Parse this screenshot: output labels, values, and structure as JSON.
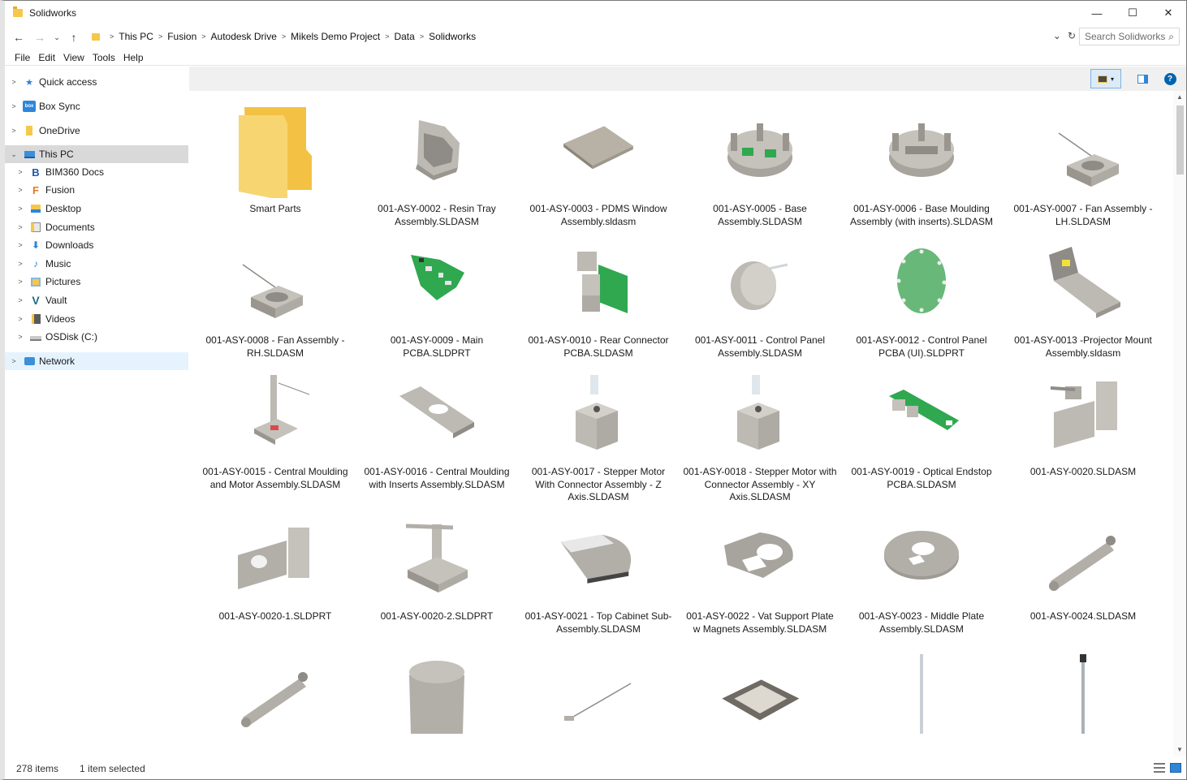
{
  "window": {
    "title": "Solidworks",
    "minimize": "—",
    "maximize": "☐",
    "close": "✕"
  },
  "address": {
    "crumbs": [
      "This PC",
      "Fusion",
      "Autodesk Drive",
      "Mikels Demo Project",
      "Data",
      "Solidworks"
    ],
    "search_placeholder": "Search Solidworks"
  },
  "menu": [
    "File",
    "Edit",
    "View",
    "Tools",
    "Help"
  ],
  "nav": {
    "quick_access": "Quick access",
    "box_sync": "Box Sync",
    "onedrive": "OneDrive",
    "this_pc": "This PC",
    "bim360": "BIM360 Docs",
    "fusion": "Fusion",
    "desktop": "Desktop",
    "documents": "Documents",
    "downloads": "Downloads",
    "music": "Music",
    "pictures": "Pictures",
    "vault": "Vault",
    "videos": "Videos",
    "osdisk": "OSDisk (C:)",
    "network": "Network",
    "icon_box": "box",
    "icon_bim": "B",
    "icon_fusion": "F",
    "icon_vault": "V"
  },
  "files": [
    "Smart Parts",
    "001-ASY-0002 - Resin Tray Assembly.SLDASM",
    "001-ASY-0003 - PDMS Window Assembly.sldasm",
    "001-ASY-0005 - Base Assembly.SLDASM",
    "001-ASY-0006 - Base Moulding Assembly (with inserts).SLDASM",
    "001-ASY-0007 - Fan Assembly - LH.SLDASM",
    "001-ASY-0008 - Fan Assembly - RH.SLDASM",
    "001-ASY-0009 - Main PCBA.SLDPRT",
    "001-ASY-0010 - Rear Connector PCBA.SLDASM",
    "001-ASY-0011 - Control Panel Assembly.SLDASM",
    "001-ASY-0012 - Control Panel PCBA (UI).SLDPRT",
    "001-ASY-0013 -Projector Mount Assembly.sldasm",
    "001-ASY-0015 - Central Moulding and Motor Assembly.SLDASM",
    "001-ASY-0016 - Central Moulding with Inserts Assembly.SLDASM",
    "001-ASY-0017 - Stepper Motor With Connector Assembly - Z Axis.SLDASM",
    "001-ASY-0018 - Stepper Motor with Connector Assembly - XY Axis.SLDASM",
    "001-ASY-0019 - Optical Endstop PCBA.SLDASM",
    "001-ASY-0020.SLDASM",
    "001-ASY-0020-1.SLDPRT",
    "001-ASY-0020-2.SLDPRT",
    "001-ASY-0021 - Top Cabinet Sub-Assembly.SLDASM",
    "001-ASY-0022 - Vat Support Plate w Magnets Assembly.SLDASM",
    "001-ASY-0023 - Middle Plate Assembly.SLDASM",
    "001-ASY-0024.SLDASM",
    "",
    "",
    "",
    "",
    "",
    ""
  ],
  "status": {
    "count": "278 items",
    "selected": "1 item selected"
  },
  "colors": {
    "folder": "#f5c84c",
    "part_grey": "#bdb9b3",
    "pcb_green": "#2fa84f",
    "selected_nav": "#d9d9d9",
    "accent_blue": "#0063b1"
  }
}
